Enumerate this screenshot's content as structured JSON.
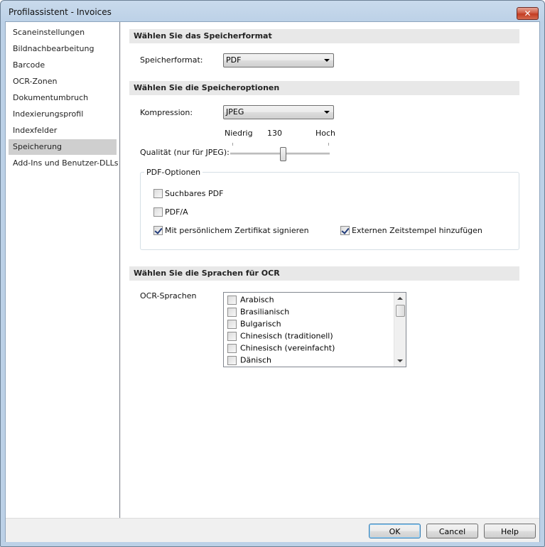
{
  "window": {
    "title": "Profilassistent - Invoices",
    "close_glyph": "✕"
  },
  "sidebar": {
    "items": [
      {
        "label": "Scaneinstellungen",
        "selected": false
      },
      {
        "label": "Bildnachbearbeitung",
        "selected": false
      },
      {
        "label": "Barcode",
        "selected": false
      },
      {
        "label": "OCR-Zonen",
        "selected": false
      },
      {
        "label": "Dokumentumbruch",
        "selected": false
      },
      {
        "label": "Indexierungsprofil",
        "selected": false
      },
      {
        "label": "Indexfelder",
        "selected": false
      },
      {
        "label": "Speicherung",
        "selected": true
      },
      {
        "label": "Add-Ins und Benutzer-DLLs",
        "selected": false
      }
    ]
  },
  "format_section": {
    "heading": "Wählen Sie das Speicherformat",
    "label": "Speicherformat:",
    "value": "PDF"
  },
  "options_section": {
    "heading": "Wählen Sie die Speicheroptionen",
    "compression_label": "Kompression:",
    "compression_value": "JPEG",
    "slider_low": "Niedrig",
    "slider_value": "130",
    "slider_high": "Hoch",
    "quality_label": "Qualität (nur für JPEG):",
    "pdf_group": {
      "title": "PDF-Optionen",
      "searchable_label": "Suchbares PDF",
      "searchable_checked": false,
      "pdfa_label": "PDF/A",
      "pdfa_checked": false,
      "sign_label": "Mit persönlichem Zertifikat signieren",
      "sign_checked": true,
      "timestamp_label": "Externen Zeitstempel hinzufügen",
      "timestamp_checked": true
    }
  },
  "ocr_section": {
    "heading": "Wählen Sie die Sprachen für OCR",
    "label": "OCR-Sprachen",
    "languages": [
      {
        "label": "Arabisch",
        "checked": false
      },
      {
        "label": "Brasilianisch",
        "checked": false
      },
      {
        "label": "Bulgarisch",
        "checked": false
      },
      {
        "label": "Chinesisch (traditionell)",
        "checked": false
      },
      {
        "label": "Chinesisch (vereinfacht)",
        "checked": false
      },
      {
        "label": "Dänisch",
        "checked": false
      }
    ]
  },
  "footer": {
    "ok_label": "OK",
    "cancel_label": "Cancel",
    "help_label": "Help"
  }
}
